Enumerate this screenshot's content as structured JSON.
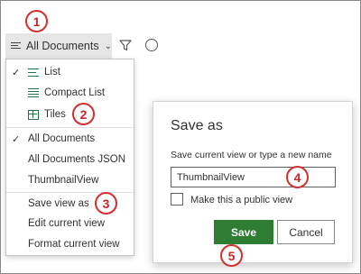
{
  "view_switcher": {
    "label": "All Documents"
  },
  "menu": {
    "layout_items": [
      {
        "label": "List",
        "checked": true,
        "icon": "list-icon"
      },
      {
        "label": "Compact List",
        "checked": false,
        "icon": "compact-list-icon"
      },
      {
        "label": "Tiles",
        "checked": false,
        "icon": "tiles-icon"
      }
    ],
    "view_items": [
      {
        "label": "All Documents",
        "checked": true
      },
      {
        "label": "All Documents JSON",
        "checked": false
      },
      {
        "label": "ThumbnailView",
        "checked": false
      }
    ],
    "action_items": [
      {
        "label": "Save view as"
      },
      {
        "label": "Edit current view"
      },
      {
        "label": "Format current view"
      }
    ]
  },
  "dialog": {
    "title": "Save as",
    "name_label": "Save current view or type a new name",
    "name_value": "ThumbnailView",
    "public_label": "Make this a public view",
    "public_checked": false,
    "save_label": "Save",
    "cancel_label": "Cancel"
  },
  "callouts": [
    "1",
    "2",
    "3",
    "4",
    "5"
  ],
  "colors": {
    "accent_green": "#2e7d32",
    "icon_green": "#217346",
    "callout_red": "#d32f2f",
    "switcher_bg": "#e6e6e6"
  }
}
